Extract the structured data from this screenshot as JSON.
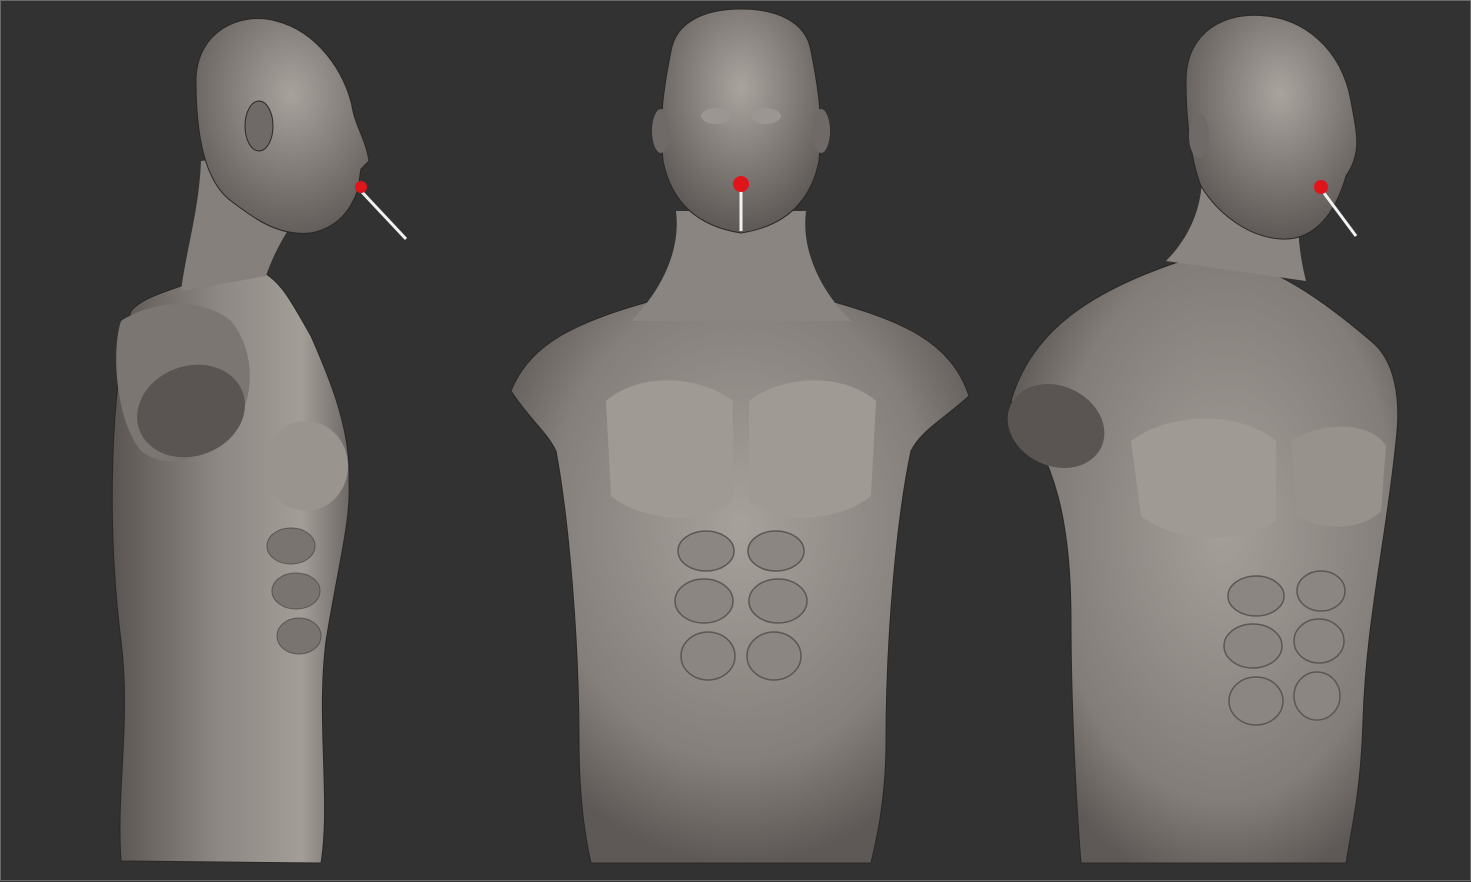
{
  "scene": {
    "background_color": "#323232",
    "frame_color": "#6b6b6b",
    "clay_color": "#8a8480",
    "clay_shadow": "#4a4644",
    "clay_highlight": "#b4aea9",
    "accent_color": "#e0141b",
    "stick_color": "#f2f2f2"
  },
  "views": [
    {
      "name": "side",
      "icon": "profile-bust-icon"
    },
    {
      "name": "front",
      "icon": "front-bust-icon"
    },
    {
      "name": "three-quarter",
      "icon": "three-quarter-bust-icon"
    }
  ]
}
